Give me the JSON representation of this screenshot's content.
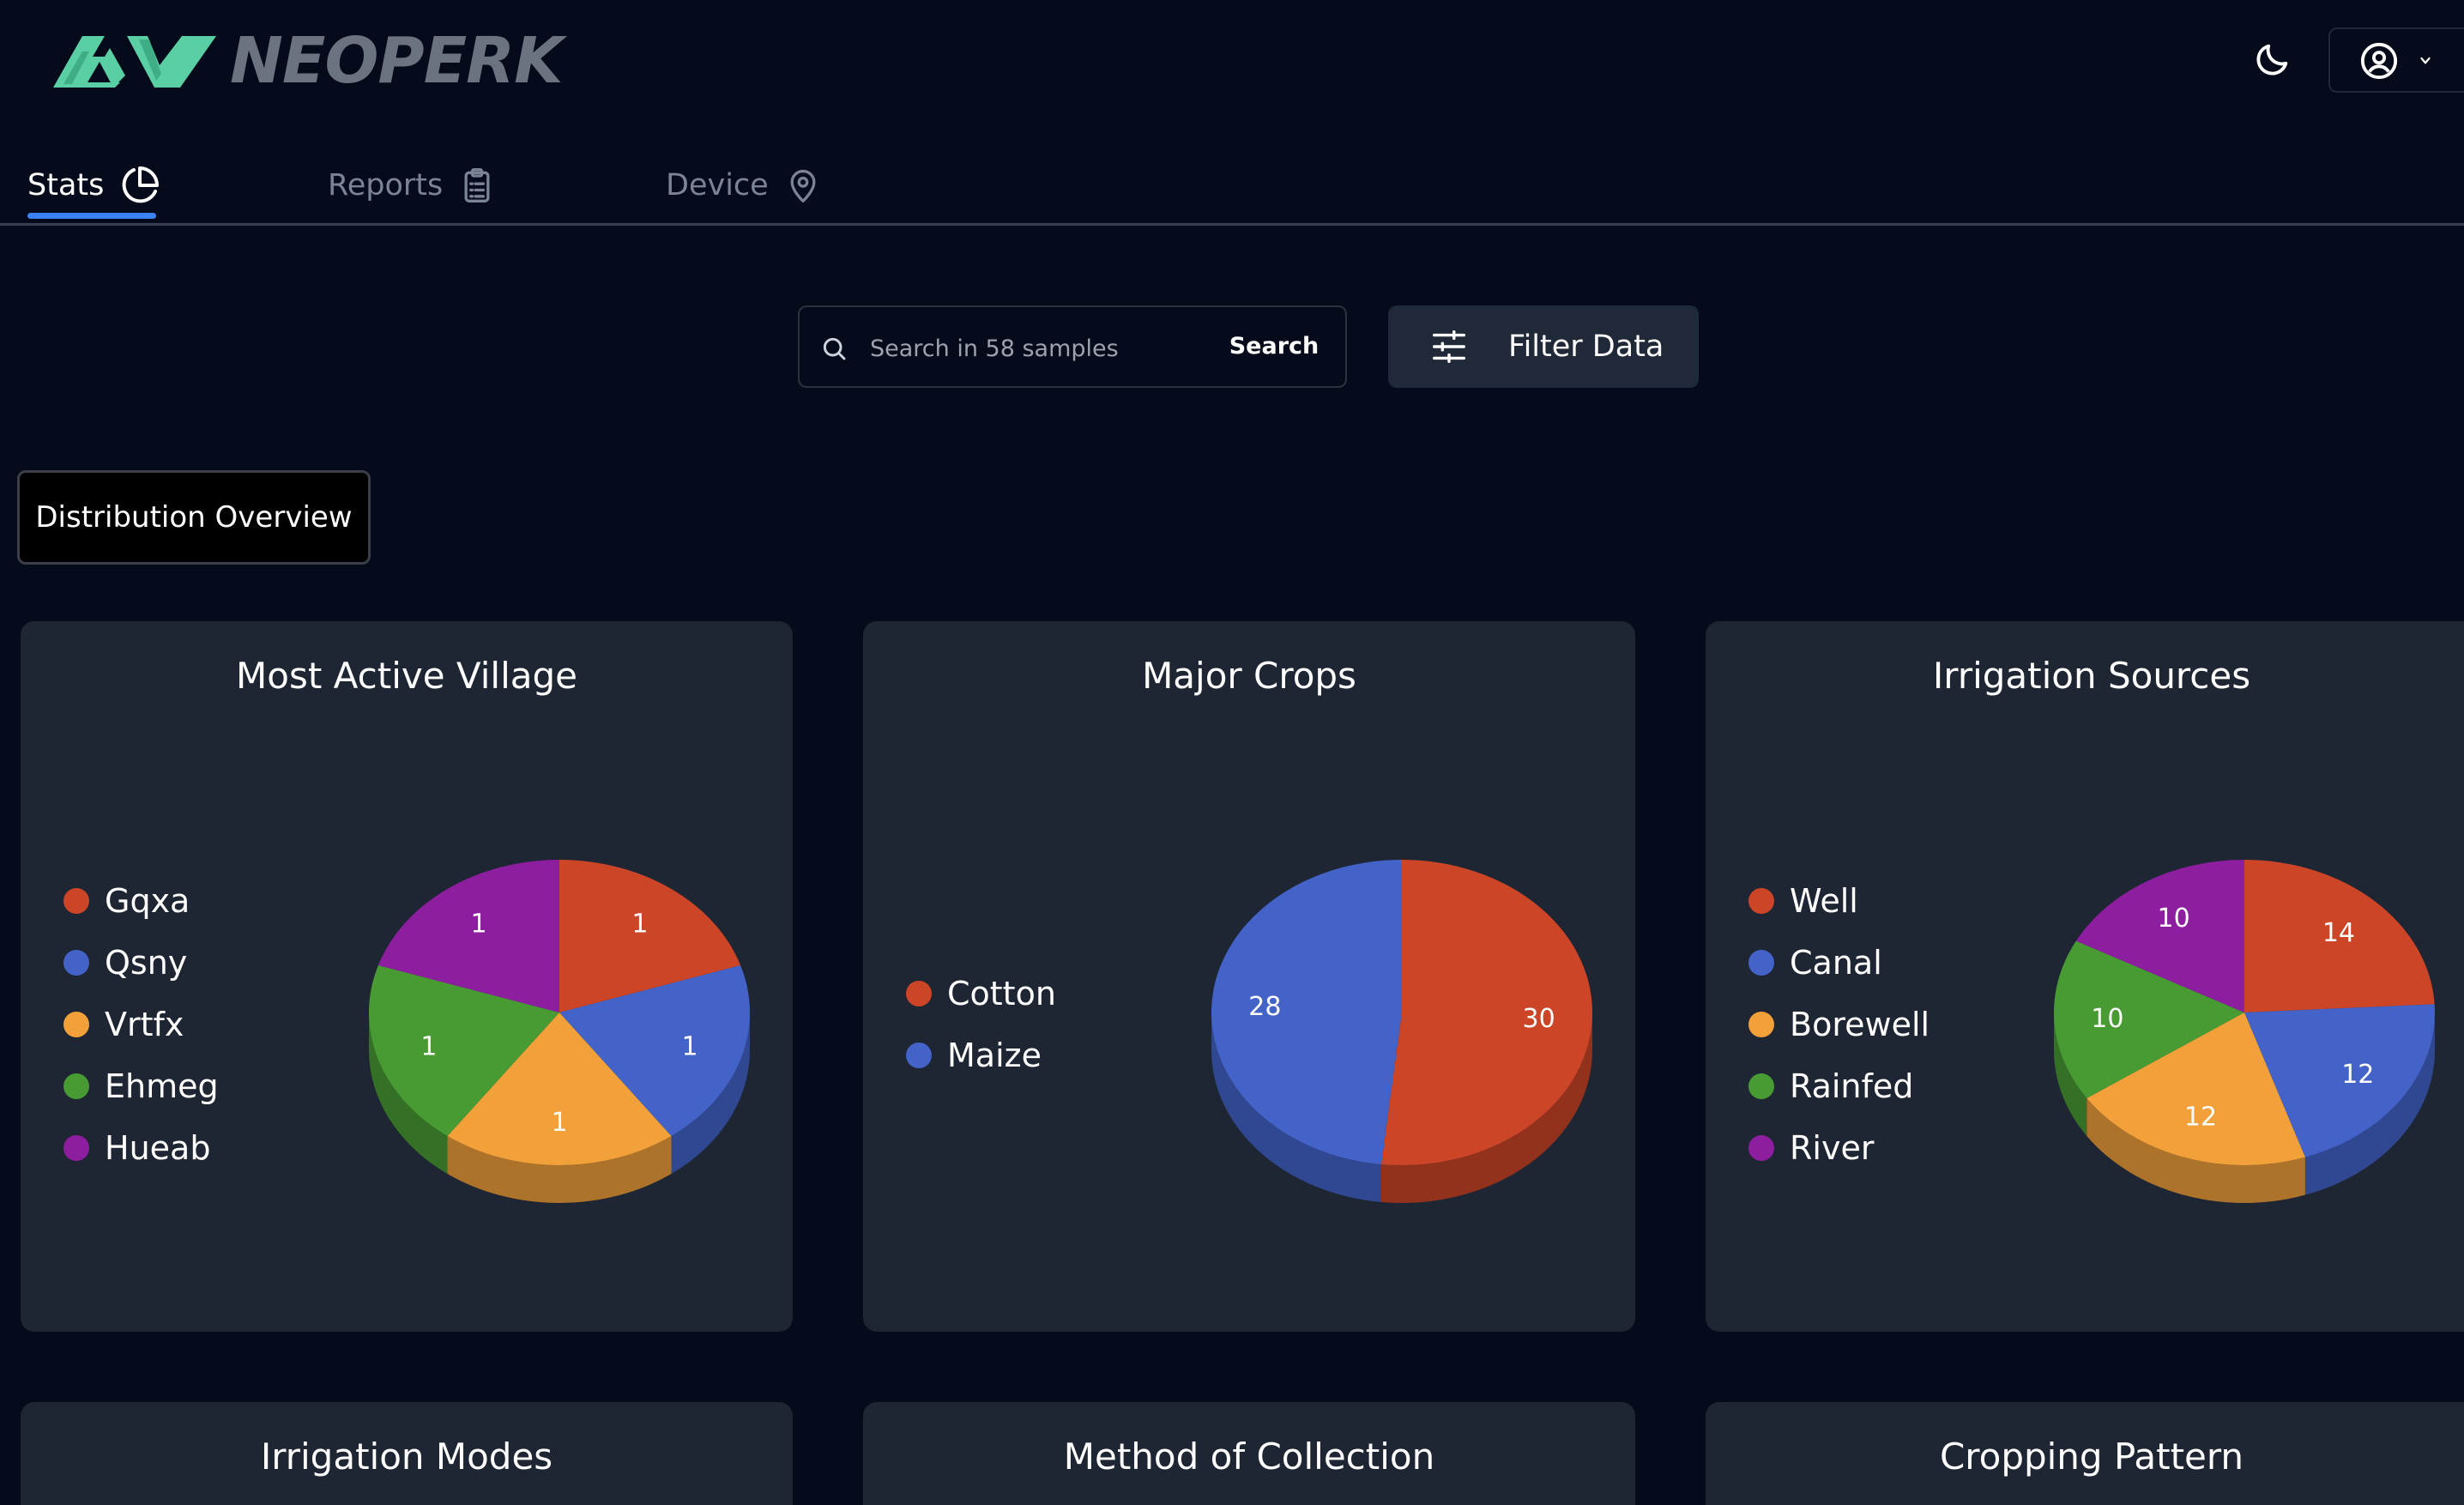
{
  "app": {
    "logo_text": "NEOPERK",
    "brand_color": "#5bcfa4"
  },
  "header": {
    "theme_icon": "moon-icon",
    "user_icon": "user-circle-icon"
  },
  "tabs": [
    {
      "label": "Stats",
      "icon": "pie-chart-icon",
      "active": true
    },
    {
      "label": "Reports",
      "icon": "clipboard-icon",
      "active": false
    },
    {
      "label": "Device",
      "icon": "map-pin-icon",
      "active": false
    }
  ],
  "search": {
    "placeholder": "Search in 58 samples",
    "value": "",
    "button_label": "Search"
  },
  "filter": {
    "label": "Filter Data",
    "icon": "sliders-icon"
  },
  "overview_button": {
    "label": "Distribution Overview"
  },
  "colors": {
    "red": "#cc4527",
    "blue": "#4363c9",
    "orange": "#f2a03a",
    "green": "#489b33",
    "purple": "#8e1ea0"
  },
  "cards": [
    {
      "title": "Most Active Village"
    },
    {
      "title": "Major Crops"
    },
    {
      "title": "Irrigation Sources"
    }
  ],
  "bottom_cards": [
    {
      "title": "Irrigation Modes"
    },
    {
      "title": "Method of Collection"
    },
    {
      "title": "Cropping Pattern"
    }
  ],
  "chart_data": [
    {
      "type": "pie",
      "title": "Most Active Village",
      "categories": [
        "Gqxa",
        "Qsny",
        "Vrtfx",
        "Ehmeg",
        "Hueab"
      ],
      "values": [
        1,
        1,
        1,
        1,
        1
      ],
      "colors": [
        "#cc4527",
        "#4363c9",
        "#f2a03a",
        "#489b33",
        "#8e1ea0"
      ],
      "legend_position": "left"
    },
    {
      "type": "pie",
      "title": "Major Crops",
      "categories": [
        "Cotton",
        "Maize"
      ],
      "values": [
        30,
        28
      ],
      "colors": [
        "#cc4527",
        "#4363c9"
      ],
      "legend_position": "left"
    },
    {
      "type": "pie",
      "title": "Irrigation Sources",
      "categories": [
        "Well",
        "Canal",
        "Borewell",
        "Rainfed",
        "River"
      ],
      "values": [
        14,
        12,
        12,
        10,
        10
      ],
      "colors": [
        "#cc4527",
        "#4363c9",
        "#f2a03a",
        "#489b33",
        "#8e1ea0"
      ],
      "legend_position": "left"
    }
  ]
}
